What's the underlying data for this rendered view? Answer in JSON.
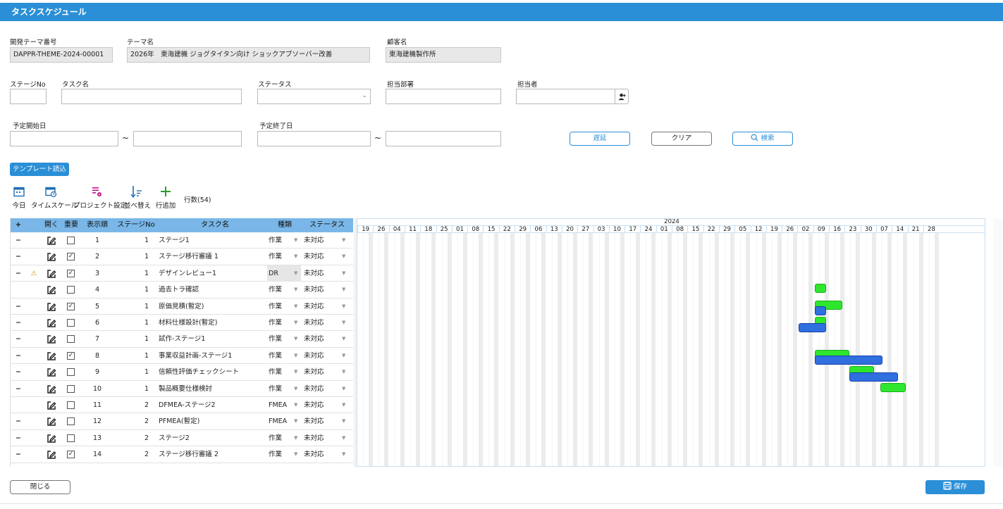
{
  "title": "タスクスケジュール",
  "header": {
    "theme_no_label": "開発テーマ番号",
    "theme_no_value": "DAPPR-THEME-2024-00001",
    "theme_name_label": "テーマ名",
    "theme_name_value": "2026年　東海建機 ジョグタイタン向け ショックアブソーバー改善",
    "customer_label": "顧客名",
    "customer_value": "東海建機製作所"
  },
  "filters": {
    "stage_no_label": "ステージNo",
    "task_name_label": "タスク名",
    "status_label": "ステータス",
    "dept_label": "担当部署",
    "person_label": "担当者",
    "start_label": "予定開始日",
    "end_label": "予定終了日",
    "tilde": "~"
  },
  "buttons": {
    "delay": "遅延",
    "clear": "クリア",
    "search": "検索",
    "template": "テンプレート読込",
    "close": "閉じる",
    "save": "保存"
  },
  "toolbar": {
    "today": "今日",
    "timescale": "タイムスケール",
    "project_settings": "プロジェクト設定",
    "sort": "並べ替え",
    "add_row": "行追加",
    "row_count": "行数(54)"
  },
  "grid": {
    "headers": {
      "plus": "+",
      "open": "開く",
      "important": "重要",
      "order": "表示順",
      "stage": "ステージNo",
      "task": "タスク名",
      "kind": "種類",
      "status": "ステータス"
    },
    "rows": [
      {
        "minus": "−",
        "warn": "",
        "important": false,
        "order": "1",
        "stage": "1",
        "name": "ステージ1",
        "kind": "作業",
        "status": "未対応"
      },
      {
        "minus": "−",
        "warn": "",
        "important": true,
        "order": "2",
        "stage": "1",
        "name": "ステージ移行審議 1",
        "kind": "作業",
        "status": "未対応"
      },
      {
        "minus": "−",
        "warn": "⚠",
        "important": true,
        "order": "3",
        "stage": "1",
        "name": "デザインレビュー1",
        "kind": "DR",
        "status": "未対応"
      },
      {
        "minus": "",
        "warn": "",
        "important": false,
        "order": "4",
        "stage": "1",
        "name": "過去トラ確認",
        "kind": "作業",
        "status": "未対応"
      },
      {
        "minus": "−",
        "warn": "",
        "important": true,
        "order": "5",
        "stage": "1",
        "name": "原価見積(暫定)",
        "kind": "作業",
        "status": "未対応"
      },
      {
        "minus": "−",
        "warn": "",
        "important": false,
        "order": "6",
        "stage": "1",
        "name": "材料仕様設計(暫定)",
        "kind": "作業",
        "status": "未対応"
      },
      {
        "minus": "−",
        "warn": "",
        "important": false,
        "order": "7",
        "stage": "1",
        "name": "試作-ステージ1",
        "kind": "作業",
        "status": "未対応"
      },
      {
        "minus": "−",
        "warn": "",
        "important": true,
        "order": "8",
        "stage": "1",
        "name": "事業収益計画-ステージ1",
        "kind": "作業",
        "status": "未対応"
      },
      {
        "minus": "−",
        "warn": "",
        "important": false,
        "order": "9",
        "stage": "1",
        "name": "信頼性評価チェックシート",
        "kind": "作業",
        "status": "未対応"
      },
      {
        "minus": "−",
        "warn": "",
        "important": false,
        "order": "10",
        "stage": "1",
        "name": "製品概要仕様検討",
        "kind": "作業",
        "status": "未対応"
      },
      {
        "minus": "",
        "warn": "",
        "important": false,
        "order": "11",
        "stage": "2",
        "name": "DFMEA-ステージ2",
        "kind": "FMEA",
        "status": "未対応"
      },
      {
        "minus": "−",
        "warn": "",
        "important": false,
        "order": "12",
        "stage": "2",
        "name": "PFMEA(暫定)",
        "kind": "FMEA",
        "status": "未対応"
      },
      {
        "minus": "−",
        "warn": "",
        "important": false,
        "order": "13",
        "stage": "2",
        "name": "ステージ2",
        "kind": "作業",
        "status": "未対応"
      },
      {
        "minus": "−",
        "warn": "",
        "important": true,
        "order": "14",
        "stage": "2",
        "name": "ステージ移行審議 2",
        "kind": "作業",
        "status": "未対応"
      }
    ]
  },
  "gantt": {
    "year": "2024",
    "weeks": [
      "19",
      "26",
      "04",
      "11",
      "18",
      "25",
      "01",
      "08",
      "15",
      "22",
      "29",
      "06",
      "13",
      "20",
      "27",
      "03",
      "10",
      "17",
      "24",
      "01",
      "08",
      "15",
      "22",
      "29",
      "05",
      "12",
      "19",
      "26",
      "02",
      "09",
      "16",
      "23",
      "30",
      "07",
      "14",
      "21",
      "28"
    ],
    "colors": {
      "planned": "#2ee62e",
      "actual": "#2f6fe0"
    },
    "bars": [
      {
        "row": 3,
        "type": "planned",
        "start_week": 29.0,
        "weeks": 0.75
      },
      {
        "row": 4,
        "type": "planned",
        "start_week": 29.0,
        "weeks": 1.75
      },
      {
        "row": 4,
        "type": "actual",
        "start_week": 29.0,
        "weeks": 0.75,
        "offset": 0.45
      },
      {
        "row": 5,
        "type": "planned",
        "start_week": 29.0,
        "weeks": 0.75
      },
      {
        "row": 5,
        "type": "actual",
        "start_week": 28.0,
        "weeks": 1.75,
        "offset": 0.45
      },
      {
        "row": 7,
        "type": "planned",
        "start_week": 29.0,
        "weeks": 2.2
      },
      {
        "row": 7,
        "type": "actual",
        "start_week": 29.0,
        "weeks": 4.3,
        "offset": 0.45
      },
      {
        "row": 8,
        "type": "planned",
        "start_week": 31.2,
        "weeks": 1.6
      },
      {
        "row": 8,
        "type": "actual",
        "start_week": 31.2,
        "weeks": 3.1,
        "offset": 0.45
      },
      {
        "row": 9,
        "type": "planned",
        "start_week": 33.2,
        "weeks": 1.6
      }
    ]
  }
}
